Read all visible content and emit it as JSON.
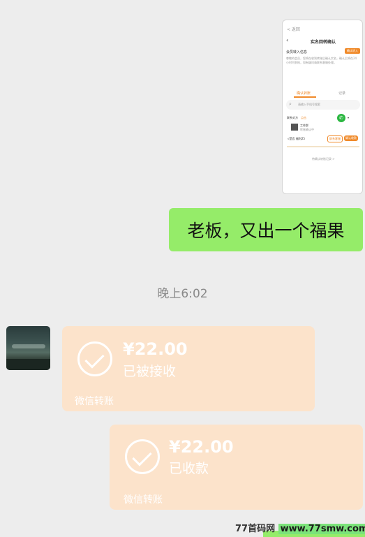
{
  "screenshot_message": {
    "back_label": "< 返回",
    "title": "实名回转确认",
    "section_title": "会员转入信息",
    "orange_tag": "确认转入",
    "description": "尊敬的会员，您将在收到转账后确认实名，确认后将在24小时内到账，如有疑问请联系客服处理。",
    "tab_left": "确认转账",
    "tab_right": "记录",
    "search_placeholder": "请输入手机号搜索",
    "contact_label": "联系对方",
    "contact_link": "点击",
    "entry_name": "工作群",
    "entry_sub": "转账确认中",
    "result_label": "√是否 福利25",
    "btn_small_1": "联系客服",
    "btn_small_2": "确认收款",
    "footer_text": "待确认转账记录 >"
  },
  "sent_text": "老板，又出一个福果",
  "time_label": "晚上6:02",
  "transfer_received": {
    "amount": "¥22.00",
    "status": "已被接收",
    "footer": "微信转账"
  },
  "transfer_sent": {
    "amount": "¥22.00",
    "status": "已收款",
    "footer": "微信转账"
  },
  "watermark": {
    "site_name": "77首码网",
    "url": "www.77smw.com"
  }
}
